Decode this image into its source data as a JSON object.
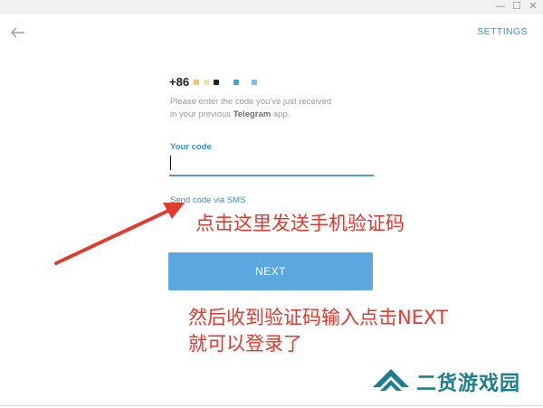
{
  "window": {
    "minimize_glyph": "—",
    "maximize_glyph": "☐",
    "close_glyph": "✕"
  },
  "header": {
    "back_icon": "arrow-left-icon",
    "settings_label": "SETTINGS"
  },
  "login": {
    "phone_prefix": "+86",
    "hint_line1": "Please enter the code you've just received",
    "hint_line2_prefix": "in your previous ",
    "hint_line2_app": "Telegram",
    "hint_line2_suffix": " app.",
    "code_label": "Your code",
    "code_value": "",
    "sms_link": "Send code via SMS",
    "next_label": "NEXT"
  },
  "annotations": {
    "arrow_text": "点击这里发送手机验证码",
    "instruction_line1": "然后收到验证码输入点击NEXT",
    "instruction_line2": "就可以登录了",
    "arrow_color": "#e23a2e"
  },
  "watermark": {
    "text": "二货游戏园",
    "color": "#1d7f8c"
  },
  "colors": {
    "accent": "#3a8fca",
    "button": "#5aa8df"
  }
}
